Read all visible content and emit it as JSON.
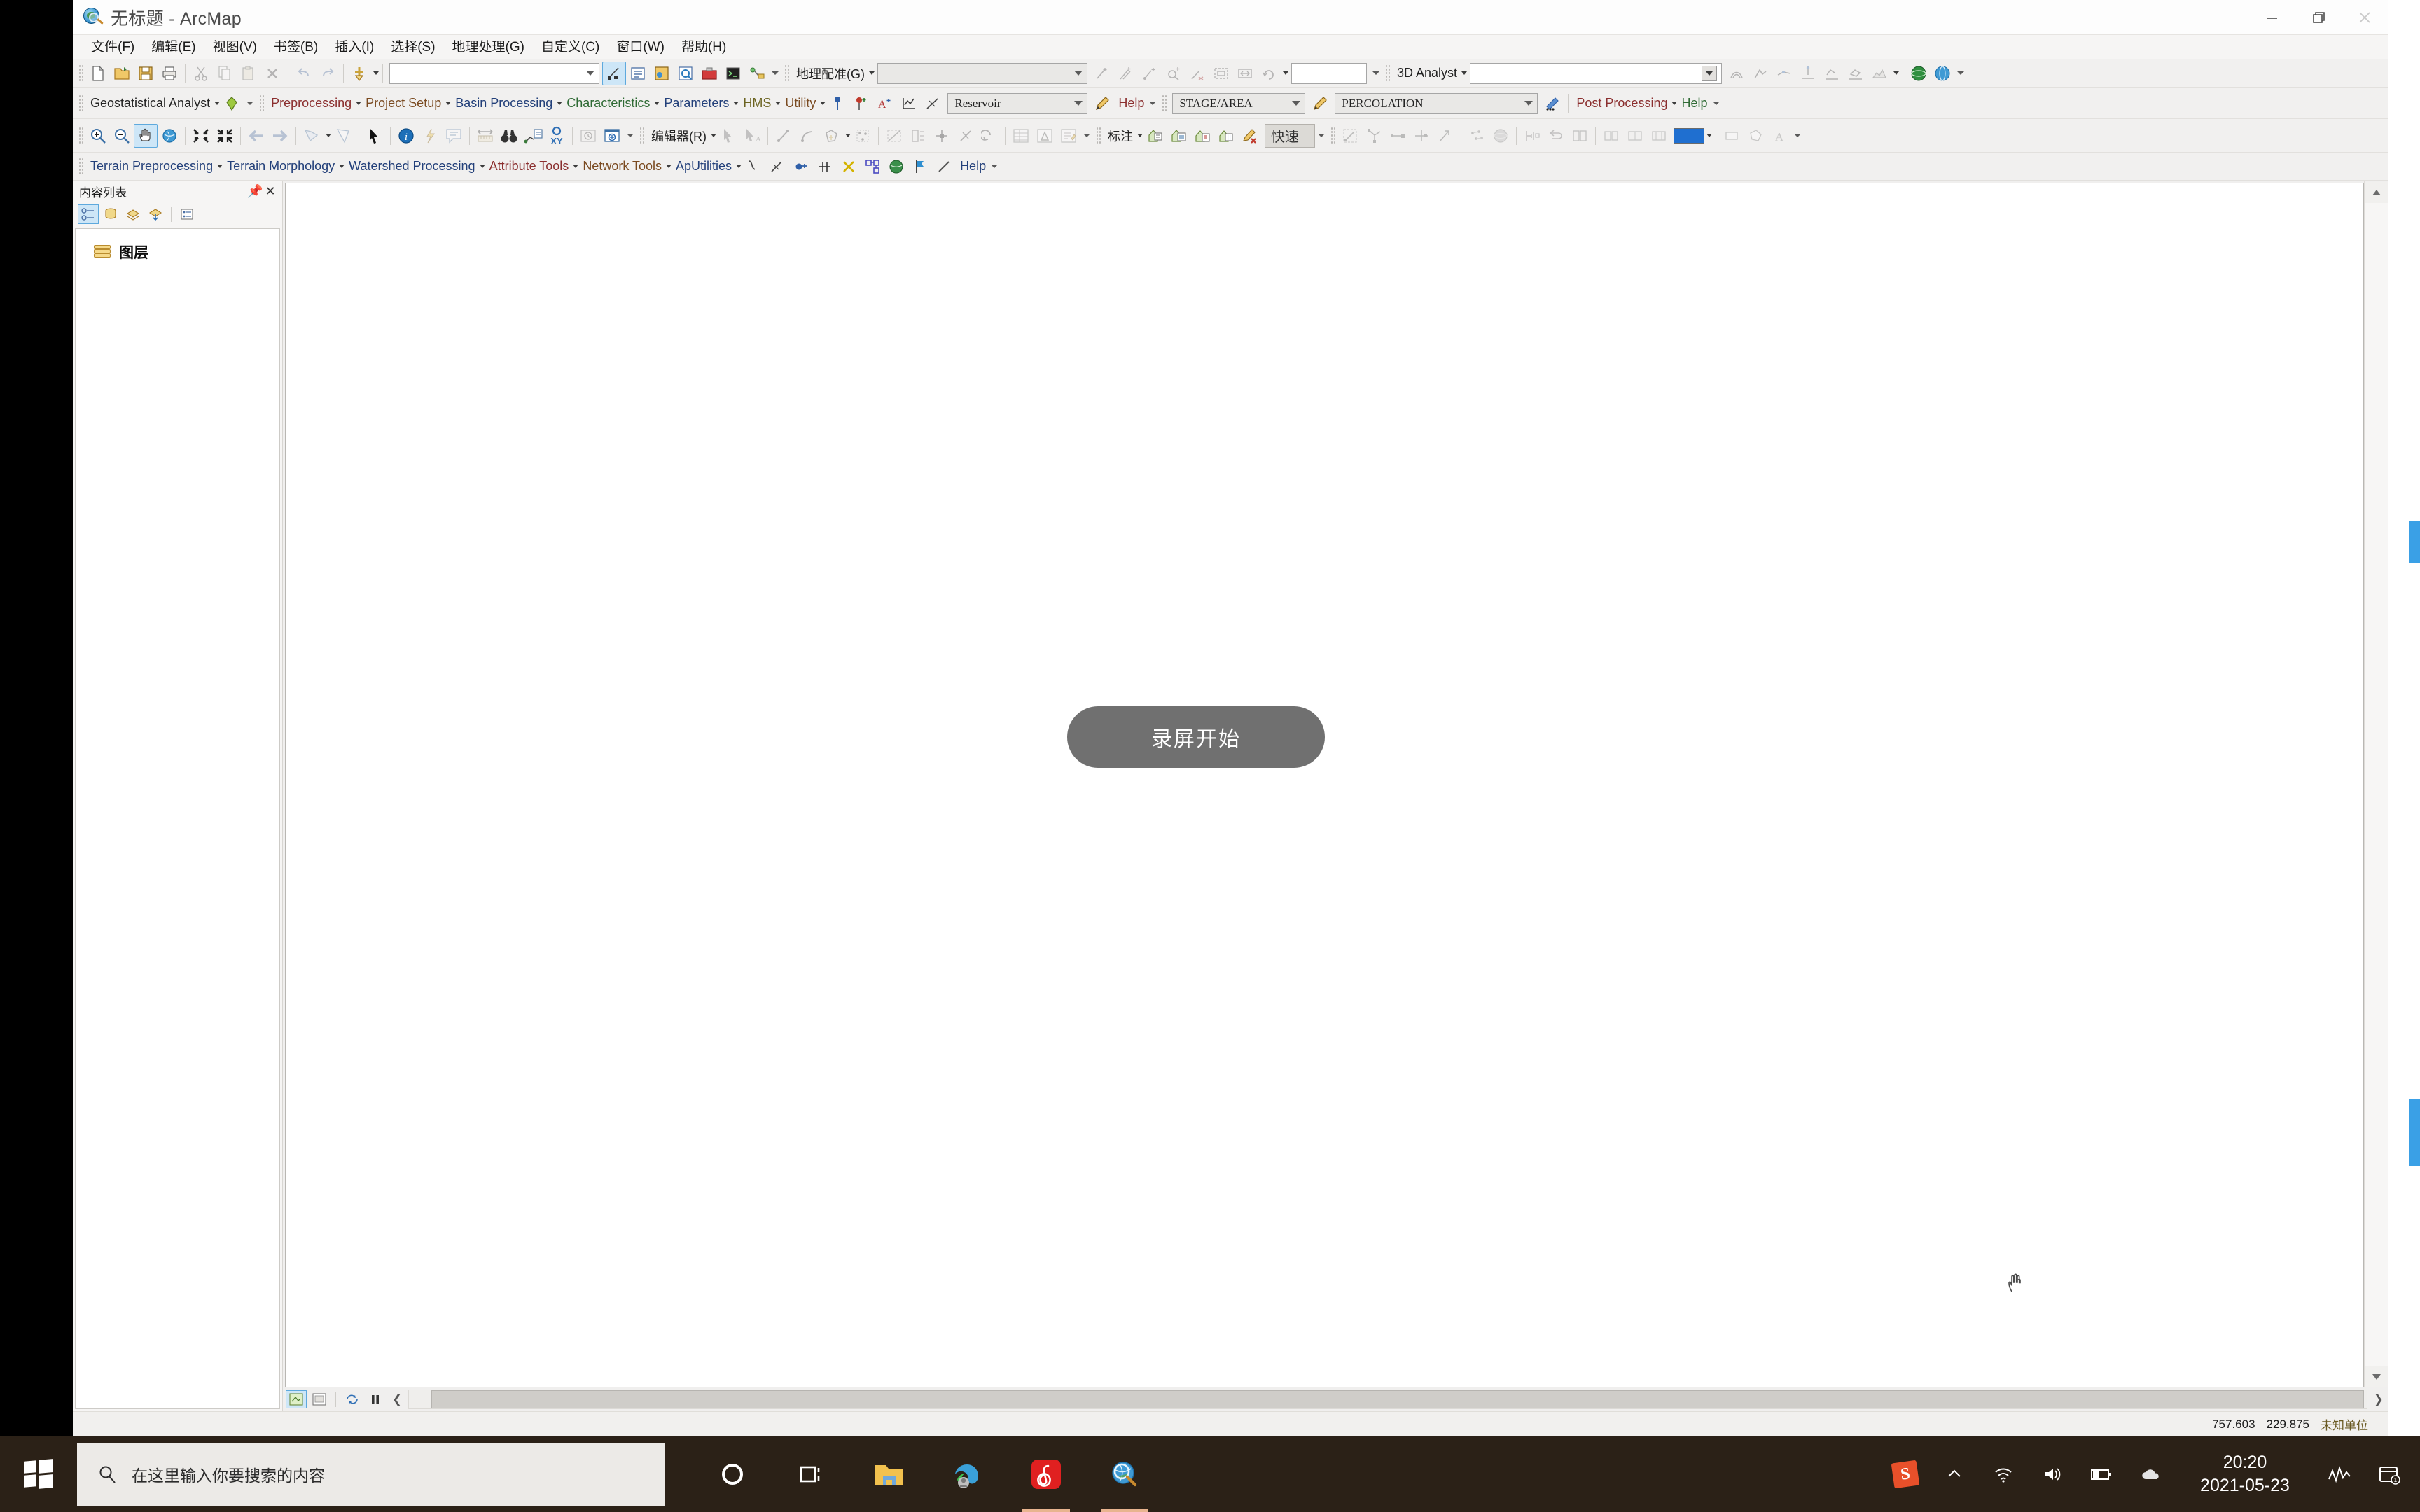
{
  "window": {
    "title": "无标题 - ArcMap",
    "icon": "arcmap-globe-icon",
    "minimize_label": "最小化",
    "restore_label": "还原",
    "close_label": "关闭"
  },
  "menubar": {
    "items": [
      {
        "label": "文件(F)",
        "name": "menu-file"
      },
      {
        "label": "编辑(E)",
        "name": "menu-edit"
      },
      {
        "label": "视图(V)",
        "name": "menu-view"
      },
      {
        "label": "书签(B)",
        "name": "menu-bookmarks"
      },
      {
        "label": "插入(I)",
        "name": "menu-insert"
      },
      {
        "label": "选择(S)",
        "name": "menu-selection"
      },
      {
        "label": "地理处理(G)",
        "name": "menu-geoprocessing"
      },
      {
        "label": "自定义(C)",
        "name": "menu-customize"
      },
      {
        "label": "窗口(W)",
        "name": "menu-window"
      },
      {
        "label": "帮助(H)",
        "name": "menu-help"
      }
    ]
  },
  "toolbars": {
    "standard": {
      "scale_combo_value": "",
      "georeferencing_label": "地理配准(G)",
      "georeferencing_combo_value": "",
      "georef_text_value": "",
      "analyst3d_label": "3D Analyst",
      "analyst3d_combo_value": ""
    },
    "row2": {
      "geostat_label": "Geostatistical Analyst",
      "preprocessing_label": "Preprocessing",
      "project_setup_label": "Project Setup",
      "basin_processing_label": "Basin Processing",
      "characteristics_label": "Characteristics",
      "parameters_label": "Parameters",
      "hms_label": "HMS",
      "utility_label": "Utility",
      "reservoir_combo_value": "Reservoir",
      "help_label": "Help",
      "stage_area_combo_value": "STAGE/AREA",
      "percolation_combo_value": "PERCOLATION",
      "post_processing_label": "Post Processing",
      "help2_label": "Help"
    },
    "row3": {
      "editor_label": "编辑器(R)",
      "label_tool_label": "标注",
      "quick_label": "快速"
    },
    "row4": {
      "terrain_preprocessing_label": "Terrain Preprocessing",
      "terrain_morphology_label": "Terrain Morphology",
      "watershed_processing_label": "Watershed Processing",
      "attribute_tools_label": "Attribute Tools",
      "network_tools_label": "Network Tools",
      "aputilities_label": "ApUtilities",
      "help_label": "Help"
    }
  },
  "toc": {
    "title": "内容列表",
    "pin_icon": "pin-icon",
    "close_icon": "close-icon",
    "root_item": "图层"
  },
  "map": {
    "recording_overlay_text": "录屏开始",
    "cursor": "pan-hand-cursor"
  },
  "statusbar": {
    "x": "757.603",
    "y": "229.875",
    "units": "未知单位"
  },
  "taskbar": {
    "search_placeholder": "在这里输入你要搜索的内容",
    "clock_time": "20:20",
    "clock_date": "2021-05-23",
    "apps": [
      {
        "name": "taskbar-cortana",
        "icon": "circle-icon"
      },
      {
        "name": "taskbar-task-view",
        "icon": "task-view-icon"
      },
      {
        "name": "taskbar-file-explorer",
        "icon": "folder-icon"
      },
      {
        "name": "taskbar-edge",
        "icon": "edge-icon"
      },
      {
        "name": "taskbar-netease-music",
        "icon": "netease-music-icon"
      },
      {
        "name": "taskbar-arcmap",
        "icon": "arcmap-globe-icon"
      }
    ]
  },
  "colors": {
    "accent_blue": "#1f6fd0",
    "highlight": "#cde6f7",
    "window_bg": "#f0efee",
    "taskbar": "#2b2117",
    "overlay": "#585858"
  }
}
